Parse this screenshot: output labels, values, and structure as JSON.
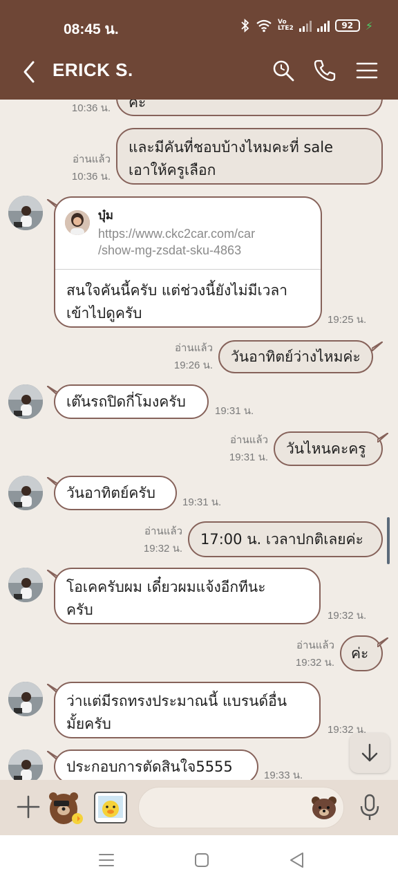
{
  "status_bar": {
    "time": "08:45 น.",
    "battery": "92",
    "network": "VoLTE2"
  },
  "header": {
    "title": "ERICK S."
  },
  "messages": [
    {
      "dir": "out",
      "text": "ค่ะ",
      "read": "",
      "time": "10:36 น."
    },
    {
      "dir": "out",
      "line1": "และมีคันที่ชอบบ้างไหมคะที่ sale",
      "line2": "เอาให้ครูเลือก",
      "read": "อ่านแล้ว",
      "time": "10:36 น."
    },
    {
      "dir": "in",
      "type": "link",
      "sender": "บุ๋ม",
      "url1": "https://www.ckc2car.com/car",
      "url2": "/show-mg-zsdat-sku-4863",
      "line1": "สนใจคันนี้ครับ แต่ช่วงนี้ยังไม่มีเวลา",
      "line2": "เข้าไปดูครับ",
      "time": "19:25 น."
    },
    {
      "dir": "out",
      "text": "วันอาทิตย์ว่างไหมค่ะ",
      "read": "อ่านแล้ว",
      "time": "19:26 น."
    },
    {
      "dir": "in",
      "text": "เต๊นรถปิดกี่โมงครับ",
      "time": "19:31 น."
    },
    {
      "dir": "out",
      "text": "วันไหนคะครู",
      "read": "อ่านแล้ว",
      "time": "19:31 น."
    },
    {
      "dir": "in",
      "text": "วันอาทิตย์ครับ",
      "time": "19:31 น."
    },
    {
      "dir": "out",
      "text": "17:00 น. เวลาปกติเลยค่ะ",
      "read": "อ่านแล้ว",
      "time": "19:32 น."
    },
    {
      "dir": "in",
      "line1": "โอเคครับผม เดี๋ยวผมแจ้งอีกทีนะ",
      "line2": "ครับ",
      "time": "19:32 น."
    },
    {
      "dir": "out",
      "text": "ค่ะ",
      "read": "อ่านแล้ว",
      "time": "19:32 น."
    },
    {
      "dir": "in",
      "line1": "ว่าแต่มีรถทรงประมาณนี้ แบรนด์อื่น",
      "line2": "มั้ยครับ",
      "time": "19:32 น."
    },
    {
      "dir": "in",
      "text": "ประกอบการตัดสินใจ5555",
      "time": "19:33 น."
    }
  ],
  "input": {
    "placeholder": ""
  },
  "colors": {
    "header": "#6e4636",
    "bubble_border": "#86625a",
    "background": "#f1ece6"
  }
}
